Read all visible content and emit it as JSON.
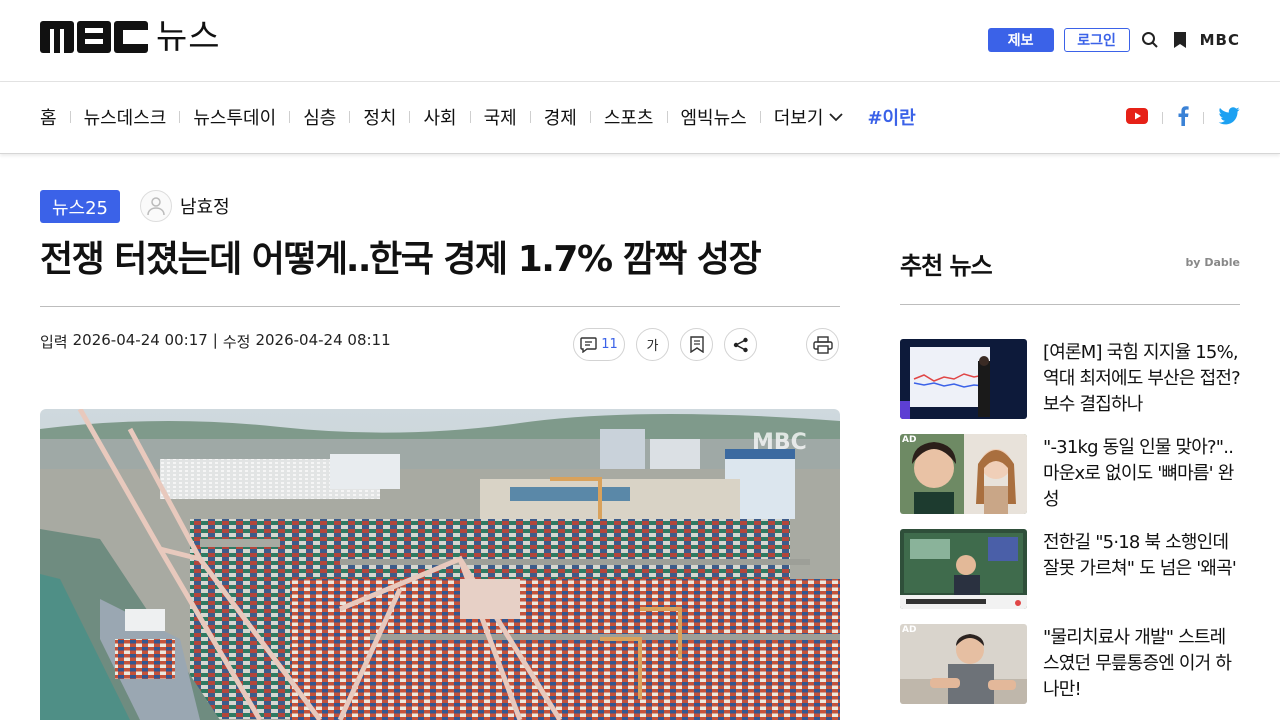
{
  "header": {
    "logo_news": "뉴스",
    "tip_button": "제보",
    "login_button": "로그인",
    "mbc_small": "MBC"
  },
  "nav": {
    "items": [
      "홈",
      "뉴스데스크",
      "뉴스투데이",
      "심층",
      "정치",
      "사회",
      "국제",
      "경제",
      "스포츠",
      "엠빅뉴스"
    ],
    "more": "더보기",
    "hashtag": "#이란"
  },
  "article": {
    "badge": "뉴스25",
    "author": "남효정",
    "headline": "전쟁 터졌는데 어떻게‥한국 경제 1.7% 깜짝 성장",
    "input_label": "입력",
    "input_date": "2026-04-24 00:17",
    "sep": "|",
    "edit_label": "수정",
    "edit_date": "2026-04-24 08:11",
    "comment_count": "11",
    "font_button": "가"
  },
  "sidebar": {
    "title": "추천 뉴스",
    "by": "by",
    "dable": "Dable",
    "items": [
      {
        "text": "[여론M] 국힘 지지율 15%, 역대 최저에도 부산은 접전? 보수 결집하나",
        "ad": false
      },
      {
        "text": "\"-31kg 동일 인물 맞아?\".. 마운x로 없이도 '뼈마름' 완성",
        "ad": true
      },
      {
        "text": "전한길 \"5·18 북 소행인데 잘못 가르쳐\" 도 넘은 '왜곡'",
        "ad": false
      },
      {
        "text": "\"물리치료사 개발\" 스트레스였던 무릎통증엔 이거 하나만!",
        "ad": true
      }
    ],
    "ad_label": "AD"
  },
  "colors": {
    "accent": "#3b62e8",
    "youtube": "#e62117",
    "facebook": "#3b82d6",
    "twitter": "#1da1f2"
  }
}
